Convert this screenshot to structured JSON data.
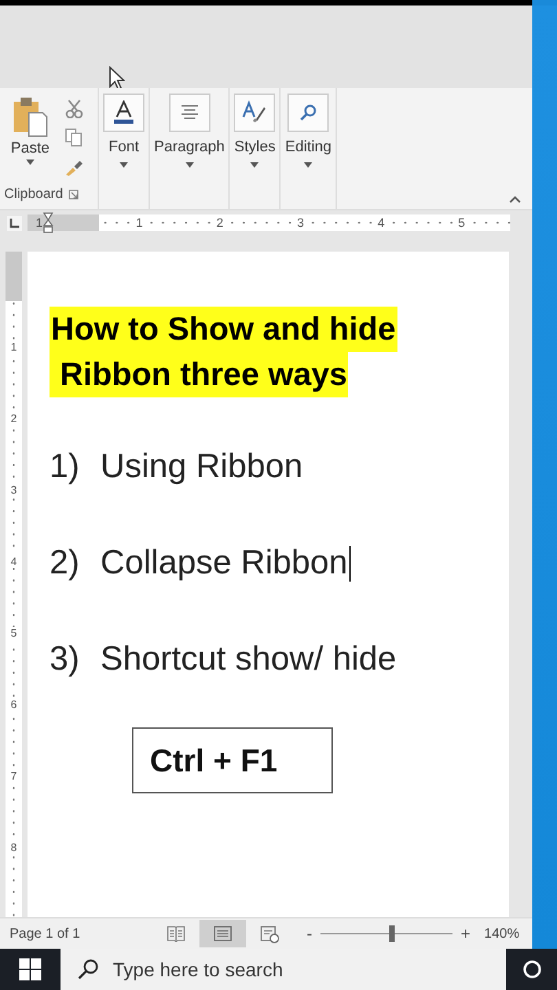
{
  "ribbon": {
    "paste": "Paste",
    "clipboard_label": "Clipboard",
    "groups": [
      {
        "label": "Font",
        "kind": "font"
      },
      {
        "label": "Paragraph",
        "kind": "paragraph"
      },
      {
        "label": "Styles",
        "kind": "styles"
      },
      {
        "label": "Editing",
        "kind": "editing"
      }
    ]
  },
  "ruler": {
    "marks": [
      "1",
      "1",
      "2",
      "3",
      "4",
      "5"
    ]
  },
  "vertical_ruler": {
    "marks": [
      "1",
      "2",
      "3",
      "4",
      "5",
      "6",
      "7",
      "8"
    ]
  },
  "document": {
    "title_lines": [
      "How to Show and hide",
      " Ribbon three ways"
    ],
    "items": [
      {
        "number": "1)",
        "text": "Using Ribbon",
        "cursor": false
      },
      {
        "number": "2)",
        "text": "Collapse Ribbon",
        "cursor": true
      },
      {
        "number": "3)",
        "text": "Shortcut show/ hide",
        "cursor": false
      }
    ],
    "shortcut": "Ctrl + F1"
  },
  "status_bar": {
    "page": "Page 1 of 1",
    "views": [
      {
        "kind": "read",
        "selected": false
      },
      {
        "kind": "print",
        "selected": true
      },
      {
        "kind": "web",
        "selected": false
      }
    ],
    "zoom": {
      "minus": "-",
      "plus": "+",
      "level": 0.54,
      "reading": "140%"
    }
  },
  "taskbar": {
    "search_placeholder": "Type here to search"
  }
}
